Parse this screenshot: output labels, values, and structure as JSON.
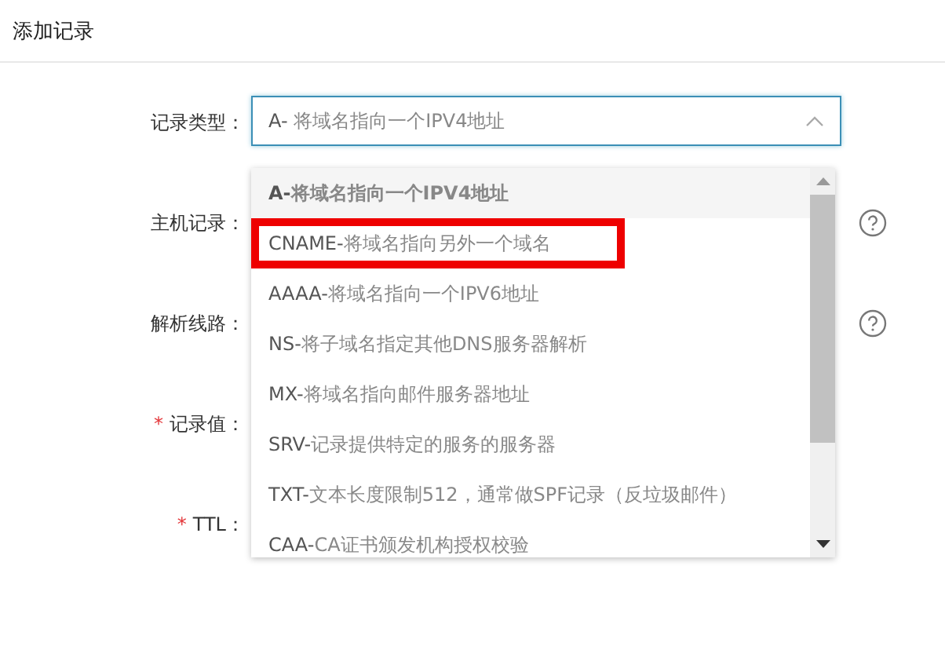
{
  "dialog": {
    "title": "添加记录"
  },
  "fields": [
    {
      "label": "记录类型：",
      "required": false,
      "help": false
    },
    {
      "label": "主机记录：",
      "required": false,
      "help": true
    },
    {
      "label": "解析线路：",
      "required": false,
      "help": true
    },
    {
      "label": "记录值：",
      "required": true,
      "help": false
    },
    {
      "label": "TTL：",
      "required": true,
      "help": false
    }
  ],
  "required_mark": "*",
  "select": {
    "type": "A-",
    "description": "将域名指向一个IPV4地址",
    "expanded": true
  },
  "options": [
    {
      "type": "A-",
      "description": "将域名指向一个IPV4地址",
      "selected": true,
      "highlighted": false
    },
    {
      "type": "CNAME-",
      "description": "将域名指向另外一个域名",
      "selected": false,
      "highlighted": true
    },
    {
      "type": "AAAA-",
      "description": "将域名指向一个IPV6地址",
      "selected": false,
      "highlighted": false
    },
    {
      "type": "NS-",
      "description": "将子域名指定其他DNS服务器解析",
      "selected": false,
      "highlighted": false
    },
    {
      "type": "MX-",
      "description": "将域名指向邮件服务器地址",
      "selected": false,
      "highlighted": false
    },
    {
      "type": "SRV-",
      "description": "记录提供特定的服务的服务器",
      "selected": false,
      "highlighted": false
    },
    {
      "type": "TXT-",
      "description": "文本长度限制512，通常做SPF记录（反垃圾邮件）",
      "selected": false,
      "highlighted": false
    },
    {
      "type": "CAA-",
      "description": "CA证书颁发机构授权校验",
      "selected": false,
      "highlighted": false
    }
  ]
}
